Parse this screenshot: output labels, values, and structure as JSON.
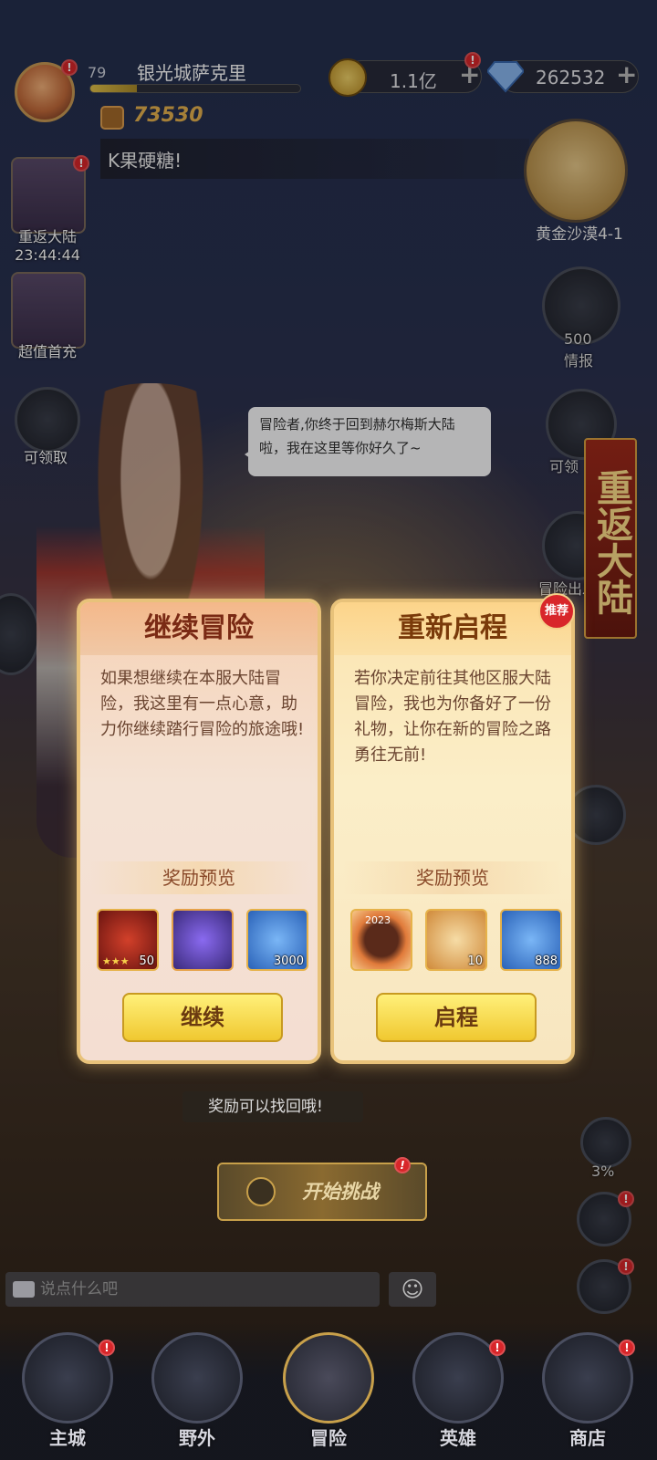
{
  "player": {
    "level": "79",
    "name": "银光城萨克里",
    "power": "73530",
    "xp_fraction": 0.22
  },
  "resources": {
    "gold": "1.1亿",
    "gems": "262532",
    "plus": "+"
  },
  "marquee": "K果硬糖!",
  "minimap": {
    "label": "黄金沙漠4-1"
  },
  "side_left": [
    {
      "label": "重返大陆",
      "timer": "23:44:44"
    },
    {
      "label": "超值首充"
    },
    {
      "label": "可领取"
    }
  ],
  "side_right": [
    {
      "count": "500",
      "label": "情报"
    },
    {
      "label": "可领"
    },
    {
      "label": "冒险出发"
    },
    {
      "label": "3%"
    }
  ],
  "speech": "冒险者,你终于回到赫尔梅斯大陆啦，我在这里等你好久了~",
  "banner": "重返大陆",
  "cards": [
    {
      "title": "继续冒险",
      "desc": "如果想继续在本服大陆冒险，我这里有一点心意，助力你继续踏行冒险的旅途哦!",
      "reward_title": "奖励预览",
      "items": [
        {
          "icon": "hero-card-icon",
          "count": "50",
          "stars": "★★★"
        },
        {
          "icon": "artifact-gem-icon",
          "count": ""
        },
        {
          "icon": "diamond-icon",
          "count": "3000"
        }
      ],
      "button": "继续"
    },
    {
      "title": "重新启程",
      "tag": "推荐",
      "desc": "若你决定前往其他区服大陆冒险，我也为你备好了一份礼物，让你在新的冒险之路勇往无前!",
      "reward_title": "奖励预览",
      "items": [
        {
          "icon": "avatar-frame-2023-icon",
          "count": "",
          "badge": "2023"
        },
        {
          "icon": "scroll-icon",
          "count": "10"
        },
        {
          "icon": "diamond-icon",
          "count": "888"
        }
      ],
      "button": "启程"
    }
  ],
  "hint": "奖励可以找回哦!",
  "challenge": "开始挑战",
  "chat": {
    "placeholder": "说点什么吧"
  },
  "nav": [
    {
      "label": "主城"
    },
    {
      "label": "野外"
    },
    {
      "label": "冒险"
    },
    {
      "label": "英雄"
    },
    {
      "label": "商店"
    }
  ],
  "colors": {
    "accent": "#e8c27a",
    "alert": "#d8262a",
    "button": "#f0c830"
  }
}
